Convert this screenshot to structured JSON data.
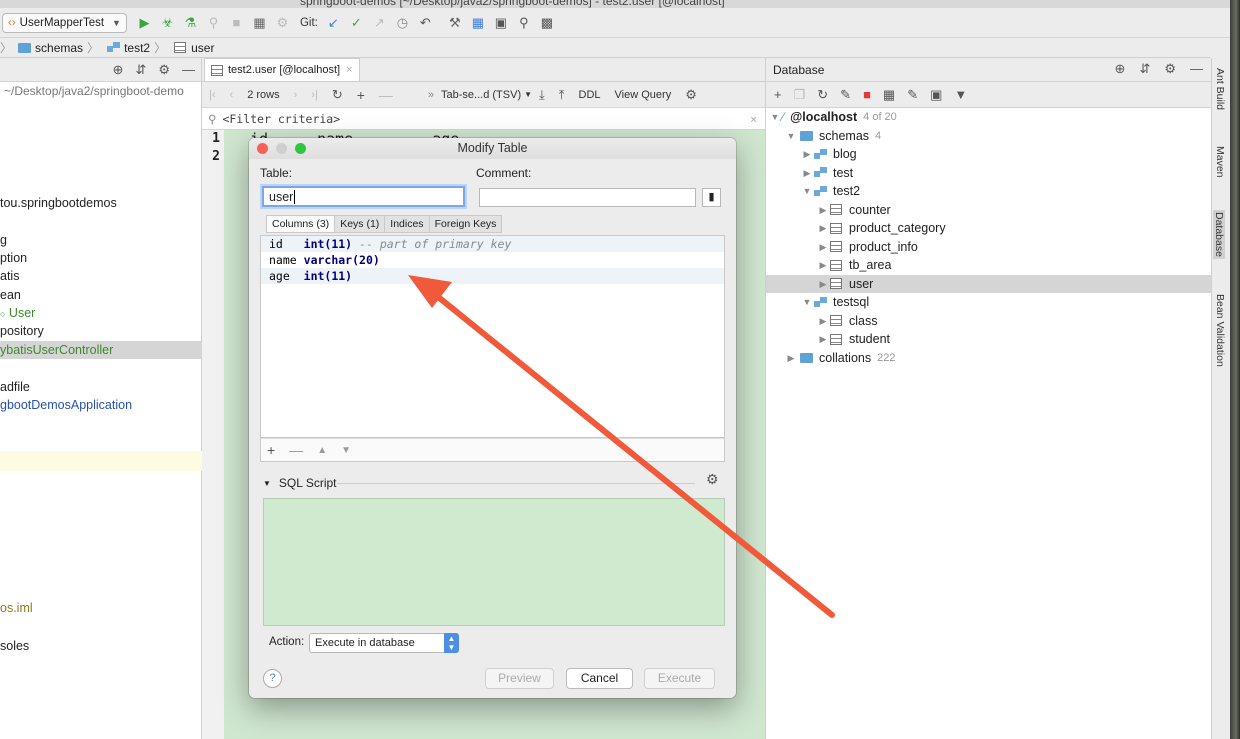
{
  "window": {
    "title": "springboot-demos [~/Desktop/java2/springboot-demos] - test2.user [@localhost]"
  },
  "toolbar": {
    "run_config": "UserMapperTest",
    "git_label": "Git:"
  },
  "breadcrumb": {
    "items": [
      "schemas",
      "test2",
      "user"
    ]
  },
  "left_panel": {
    "path": "~/Desktop/java2/springboot-demo",
    "items": [
      {
        "text": "tou.springbootdemos",
        "color": "#222"
      },
      {
        "text": "g",
        "color": "#222"
      },
      {
        "text": "ption",
        "color": "#222"
      },
      {
        "text": "atis",
        "color": "#222"
      },
      {
        "text": "ean",
        "color": "#222"
      },
      {
        "text": "User",
        "color": "#3c8a2a"
      },
      {
        "text": "pository",
        "color": "#222"
      },
      {
        "text": "ybatisUserController",
        "color": "#3c8a2a"
      },
      {
        "text": "adfile",
        "color": "#222"
      },
      {
        "text": "gbootDemosApplication",
        "color": "#2850a8"
      },
      {
        "text": "os.iml",
        "color": "#8a7a20"
      },
      {
        "text": "soles",
        "color": "#222"
      }
    ]
  },
  "editor": {
    "tab_label": "test2.user [@localhost]",
    "rows_label": "2 rows",
    "format_label": "Tab-se...d (TSV)",
    "ddl_label": "DDL",
    "view_query_label": "View Query",
    "filter_placeholder": "<Filter criteria>",
    "row_numbers": [
      "1",
      "2"
    ],
    "column_headers": [
      "id",
      "name",
      "age"
    ]
  },
  "database": {
    "header": "Database",
    "host": "@localhost",
    "host_count": "4 of 20",
    "schemas_label": "schemas",
    "schemas_count": "4",
    "tree": [
      {
        "label": "blog",
        "type": "schema"
      },
      {
        "label": "test",
        "type": "schema"
      },
      {
        "label": "test2",
        "type": "schema"
      },
      {
        "label": "counter",
        "type": "table"
      },
      {
        "label": "product_category",
        "type": "table"
      },
      {
        "label": "product_info",
        "type": "table"
      },
      {
        "label": "tb_area",
        "type": "table"
      },
      {
        "label": "user",
        "type": "table"
      },
      {
        "label": "testsql",
        "type": "schema"
      },
      {
        "label": "class",
        "type": "table"
      },
      {
        "label": "student",
        "type": "table"
      }
    ],
    "collations_label": "collations",
    "collations_count": "222"
  },
  "side_tabs": [
    "Ant Build",
    "Maven",
    "Database",
    "Bean Validation"
  ],
  "dialog": {
    "title": "Modify Table",
    "table_label": "Table:",
    "table_value": "user",
    "comment_label": "Comment:",
    "comment_value": "",
    "subtabs": [
      "Columns (3)",
      "Keys (1)",
      "Indices",
      "Foreign Keys"
    ],
    "columns": [
      {
        "name": "id",
        "type": "int(11)",
        "comment": "-- part of primary key"
      },
      {
        "name": "name",
        "type": "varchar(20)",
        "comment": ""
      },
      {
        "name": "age",
        "type": "int(11)",
        "comment": ""
      }
    ],
    "sql_script_label": "SQL Script",
    "action_label": "Action:",
    "action_value": "Execute in database",
    "preview_label": "Preview",
    "cancel_label": "Cancel",
    "execute_label": "Execute"
  },
  "colors": {
    "accent": "#4e8fe6",
    "arrow": "#f05a3a",
    "sql_bg": "#cfeacf"
  }
}
